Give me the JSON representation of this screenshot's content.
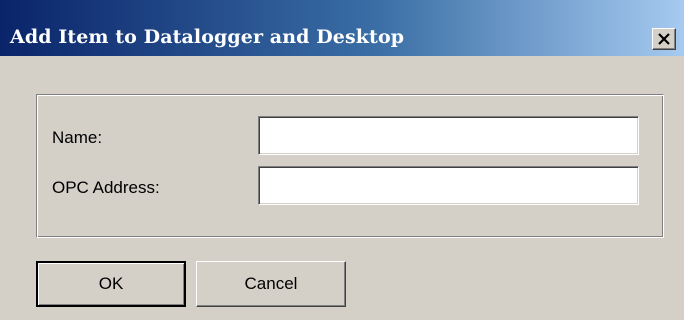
{
  "window": {
    "title": "Add Item to Datalogger and Desktop",
    "close_icon": "close-icon"
  },
  "form": {
    "name_label": "Name:",
    "name_value": "",
    "opc_label": "OPC Address:",
    "opc_value": ""
  },
  "buttons": {
    "ok_label": "OK",
    "cancel_label": "Cancel"
  },
  "colors": {
    "titlebar_start": "#0a246a",
    "titlebar_end": "#a6caf0",
    "face": "#d4d0c8"
  }
}
